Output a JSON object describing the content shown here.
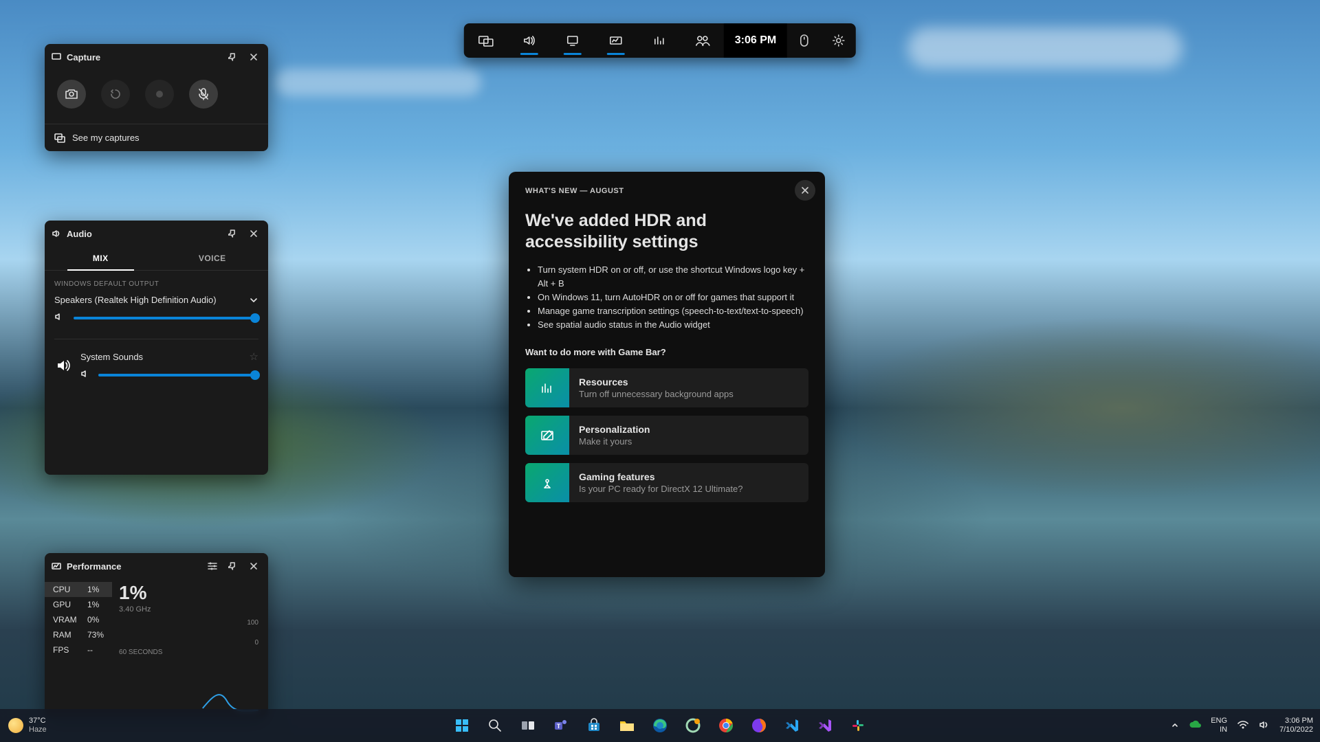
{
  "topbar": {
    "time": "3:06 PM"
  },
  "capture": {
    "title": "Capture",
    "see_link": "See my captures"
  },
  "audio": {
    "title": "Audio",
    "tab_mix": "MIX",
    "tab_voice": "VOICE",
    "default_output_label": "WINDOWS DEFAULT OUTPUT",
    "device_name": "Speakers (Realtek High Definition Audio)",
    "system_sounds_label": "System Sounds",
    "master_volume": 100,
    "system_volume": 100
  },
  "whatsnew": {
    "eyebrow": "WHAT'S NEW — AUGUST",
    "headline": "We've added HDR and accessibility settings",
    "bullets": [
      "Turn system HDR on or off, or use the shortcut Windows logo key + Alt + B",
      "On Windows 11, turn AutoHDR on or off for games that support it",
      "Manage game transcription settings (speech-to-text/text-to-speech)",
      "See spatial audio status in the Audio widget"
    ],
    "subhead": "Want to do more with Game Bar?",
    "cards": [
      {
        "title": "Resources",
        "sub": "Turn off unnecessary background apps"
      },
      {
        "title": "Personalization",
        "sub": "Make it yours"
      },
      {
        "title": "Gaming features",
        "sub": "Is your PC ready for DirectX 12 Ultimate?"
      }
    ]
  },
  "performance": {
    "title": "Performance",
    "rows": [
      {
        "label": "CPU",
        "value": "1%"
      },
      {
        "label": "GPU",
        "value": "1%"
      },
      {
        "label": "VRAM",
        "value": "0%"
      },
      {
        "label": "RAM",
        "value": "73%"
      },
      {
        "label": "FPS",
        "value": "--"
      }
    ],
    "big_value": "1%",
    "clock": "3.40 GHz",
    "y_max": "100",
    "y_min": "0",
    "x_label": "60 SECONDS"
  },
  "taskbar": {
    "temp": "37°C",
    "weather": "Haze",
    "lang1": "ENG",
    "lang2": "IN",
    "time": "3:06 PM",
    "date": "7/10/2022"
  }
}
